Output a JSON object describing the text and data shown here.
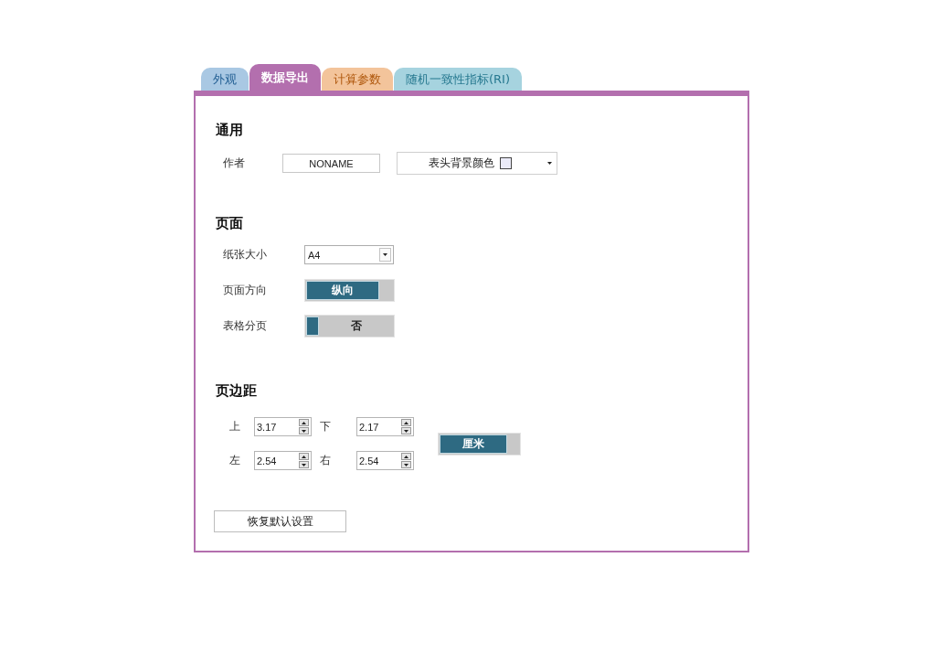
{
  "tabs": [
    {
      "label": "外观",
      "selected": false,
      "color": "#a9c8e3"
    },
    {
      "label": "数据导出",
      "selected": true,
      "color": "#b36fae"
    },
    {
      "label": "计算参数",
      "selected": false,
      "color": "#f3c49b"
    },
    {
      "label": "随机一致性指标(RI)",
      "selected": false,
      "color": "#a6d3df"
    }
  ],
  "general": {
    "heading": "通用",
    "author": {
      "label": "作者",
      "value": "NONAME"
    },
    "header_color": {
      "label": "表头背景颜色",
      "color": "#ebebf8"
    }
  },
  "page": {
    "heading": "页面",
    "rows": [
      {
        "kind": "select",
        "label": "纸张大小",
        "value": "A4"
      },
      {
        "kind": "toggle",
        "label": "页面方向",
        "value": "纵向",
        "on": true
      },
      {
        "kind": "toggle",
        "label": "表格分页",
        "value": "否",
        "on": false
      }
    ]
  },
  "margins": {
    "heading": "页边距",
    "fields": [
      {
        "label": "上",
        "value": "3.17"
      },
      {
        "label": "下",
        "value": "2.17"
      },
      {
        "label": "左",
        "value": "2.54"
      },
      {
        "label": "右",
        "value": "2.54"
      }
    ],
    "unit": {
      "value": "厘米",
      "on": true
    }
  },
  "reset_button": "恢复默认设置"
}
